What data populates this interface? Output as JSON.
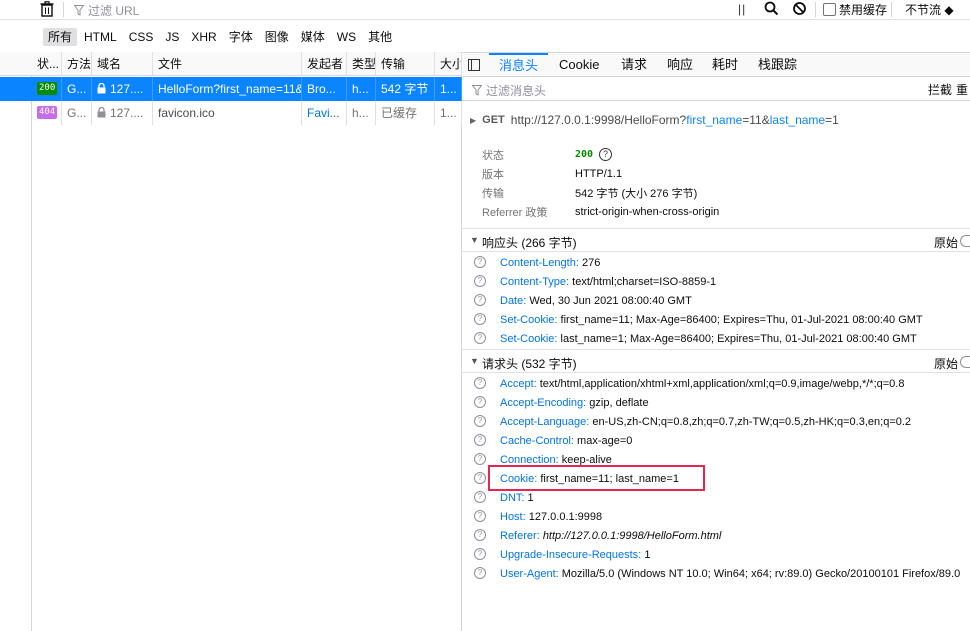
{
  "toolbar": {
    "filter_placeholder": "过滤 URL",
    "pause_label": "||",
    "disable_cache_label": "禁用缓存",
    "throttle_label": "不节流 ◆"
  },
  "type_filters": [
    "所有",
    "HTML",
    "CSS",
    "JS",
    "XHR",
    "字体",
    "图像",
    "媒体",
    "WS",
    "其他"
  ],
  "columns": [
    "状...",
    "方法",
    "域名",
    "文件",
    "发起者",
    "类型",
    "传输",
    "大小"
  ],
  "requests": [
    {
      "status": "200",
      "method": "G...",
      "domain": "127....",
      "file": "HelloForm?first_name=11&",
      "initiator": "Bro...",
      "type": "h...",
      "transfer": "542 字节",
      "size": "1...",
      "selected": true,
      "status_color": "#058b00"
    },
    {
      "status": "404",
      "method": "G...",
      "domain": "127....",
      "file": "favicon.ico",
      "initiator": "Favi...",
      "type": "h...",
      "transfer": "已缓存",
      "size": "1...",
      "selected": false,
      "status_color": "#c86de8"
    }
  ],
  "detail_tabs": [
    "消息头",
    "Cookie",
    "请求",
    "响应",
    "耗时",
    "栈跟踪"
  ],
  "detail_filter_placeholder": "过滤消息头",
  "detail_block_label": "拦截",
  "detail_more_label": "重",
  "request_line": {
    "method": "GET",
    "host": "http://127.0.0.1:9998/HelloForm?",
    "p1_name": "first_name",
    "p1_val": "=11&",
    "p2_name": "last_name",
    "p2_val": "=1"
  },
  "summary": {
    "status_label": "状态",
    "status_value": "200",
    "version_label": "版本",
    "version_value": "HTTP/1.1",
    "transfer_label": "传输",
    "transfer_value": "542 字节 (大小 276 字节)",
    "referrer_label": "Referrer 政策",
    "referrer_value": "strict-origin-when-cross-origin"
  },
  "response_section": {
    "title": "响应头 (266 字节)",
    "raw_label": "原始"
  },
  "response_headers": [
    {
      "k": "Content-Length:",
      "v": "276"
    },
    {
      "k": "Content-Type:",
      "v": "text/html;charset=ISO-8859-1"
    },
    {
      "k": "Date:",
      "v": "Wed, 30 Jun 2021 08:00:40 GMT"
    },
    {
      "k": "Set-Cookie:",
      "v": "first_name=11; Max-Age=86400; Expires=Thu, 01-Jul-2021 08:00:40 GMT"
    },
    {
      "k": "Set-Cookie:",
      "v": "last_name=1; Max-Age=86400; Expires=Thu, 01-Jul-2021 08:00:40 GMT"
    }
  ],
  "request_section": {
    "title": "请求头 (532 字节)",
    "raw_label": "原始"
  },
  "request_headers": [
    {
      "k": "Accept:",
      "v": "text/html,application/xhtml+xml,application/xml;q=0.9,image/webp,*/*;q=0.8"
    },
    {
      "k": "Accept-Encoding:",
      "v": "gzip, deflate"
    },
    {
      "k": "Accept-Language:",
      "v": "en-US,zh-CN;q=0.8,zh;q=0.7,zh-TW;q=0.5,zh-HK;q=0.3,en;q=0.2"
    },
    {
      "k": "Cache-Control:",
      "v": "max-age=0"
    },
    {
      "k": "Connection:",
      "v": "keep-alive"
    },
    {
      "k": "Cookie:",
      "v": "first_name=11; last_name=1"
    },
    {
      "k": "DNT:",
      "v": "1"
    },
    {
      "k": "Host:",
      "v": "127.0.0.1:9998"
    },
    {
      "k": "Referer:",
      "v": "http://127.0.0.1:9998/HelloForm.html"
    },
    {
      "k": "Upgrade-Insecure-Requests:",
      "v": "1"
    },
    {
      "k": "User-Agent:",
      "v": "Mozilla/5.0 (Windows NT 10.0; Win64; x64; rv:89.0) Gecko/20100101 Firefox/89.0"
    }
  ]
}
